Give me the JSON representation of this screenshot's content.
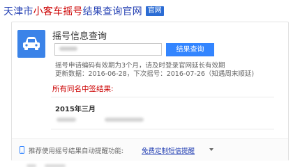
{
  "header": {
    "title_prefix": "天津市",
    "title_highlight": "小客车摇号",
    "title_suffix": "结果查询官网",
    "badge": "官网"
  },
  "card": {
    "icon": "car-icon",
    "section_title": "摇号信息查询",
    "query_button": "结果查询",
    "info_line_1": "摇号申请编码有效期为3个月，请及时登录官网延长有效期",
    "info_line_2": "更新数据：2016-06-28，下次摇号：2016-07-26（知遇周末顺延)",
    "results_heading": "所有同名中签结果:",
    "month_label": "2015年三月"
  },
  "footer": {
    "text": "推荐使用摇号结果自动提醒功能:",
    "link": "免费定制短信提醒",
    "phone_icon": "phone-icon",
    "caret_icon": "caret-down-icon"
  },
  "colors": {
    "link_blue": "#2440b3",
    "highlight_red": "#cc0000",
    "button_blue": "#3385ff",
    "icon_blue": "#3b83e8"
  }
}
